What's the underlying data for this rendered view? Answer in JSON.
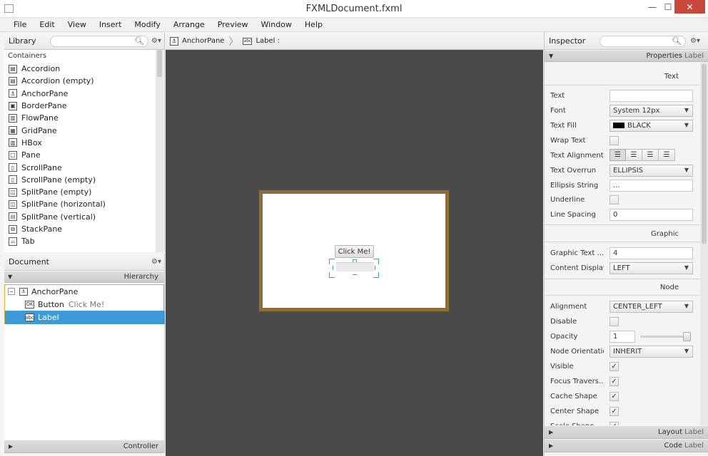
{
  "window": {
    "title": "FXMLDocument.fxml",
    "minimize_glyph": "—",
    "maximize_glyph": "☐",
    "close_glyph": "✕"
  },
  "menu": [
    "File",
    "Edit",
    "View",
    "Insert",
    "Modify",
    "Arrange",
    "Preview",
    "Window",
    "Help"
  ],
  "library": {
    "title": "Library",
    "section": "Containers",
    "items": [
      {
        "label": "Accordion",
        "icon": "▤"
      },
      {
        "label": "Accordion  (empty)",
        "icon": "▤"
      },
      {
        "label": "AnchorPane",
        "icon": "⚓"
      },
      {
        "label": "BorderPane",
        "icon": "▣"
      },
      {
        "label": "FlowPane",
        "icon": "▥"
      },
      {
        "label": "GridPane",
        "icon": "▦"
      },
      {
        "label": "HBox",
        "icon": "▥"
      },
      {
        "label": "Pane",
        "icon": "□"
      },
      {
        "label": "ScrollPane",
        "icon": "▯"
      },
      {
        "label": "ScrollPane  (empty)",
        "icon": "▯"
      },
      {
        "label": "SplitPane  (empty)",
        "icon": "◫"
      },
      {
        "label": "SplitPane  (horizontal)",
        "icon": "◫"
      },
      {
        "label": "SplitPane  (vertical)",
        "icon": "⊟"
      },
      {
        "label": "StackPane",
        "icon": "⧉"
      },
      {
        "label": "Tab",
        "icon": "⌓"
      }
    ]
  },
  "document": {
    "title": "Document",
    "hierarchy_label": "Hierarchy",
    "controller_label": "Controller",
    "tree": [
      {
        "label": "AnchorPane",
        "sub": "",
        "icon": "⚓",
        "toggle": "−"
      },
      {
        "label": "Button",
        "sub": "Click Me!",
        "icon": "OK",
        "toggle": ""
      },
      {
        "label": "Label",
        "sub": "",
        "icon": "abc",
        "toggle": ""
      }
    ]
  },
  "breadcrumb": {
    "items": [
      {
        "label": "AnchorPane",
        "icon": "⚓"
      },
      {
        "label": "Label :",
        "icon": "abc"
      }
    ]
  },
  "canvas": {
    "button_label": "Click Me!"
  },
  "inspector": {
    "title": "Inspector",
    "properties_label": "Properties",
    "properties_target": ": Label",
    "sections": {
      "text": "Text",
      "graphic": "Graphic",
      "node": "Node"
    },
    "rows": {
      "text": "Text",
      "font": "Font",
      "font_value": "System 12px",
      "text_fill": "Text Fill",
      "text_fill_value": "BLACK",
      "wrap_text": "Wrap Text",
      "text_alignment": "Text Alignment",
      "text_overrun": "Text Overrun",
      "text_overrun_value": "ELLIPSIS",
      "ellipsis_string": "Ellipsis String",
      "ellipsis_value": "...",
      "underline": "Underline",
      "line_spacing": "Line Spacing",
      "line_spacing_value": "0",
      "graphic_text_gap": "Graphic Text ...",
      "graphic_text_gap_value": "4",
      "content_display": "Content Display",
      "content_display_value": "LEFT",
      "alignment": "Alignment",
      "alignment_value": "CENTER_LEFT",
      "disable": "Disable",
      "opacity": "Opacity",
      "opacity_value": "1",
      "node_orientation": "Node Orientation",
      "node_orientation_value": "INHERIT",
      "visible": "Visible",
      "focus_traversable": "Focus Travers...",
      "cache_shape": "Cache Shape",
      "center_shape": "Center Shape",
      "scale_shape": "Scale Shape"
    },
    "layout_label": "Layout",
    "layout_target": ": Label",
    "code_label": "Code",
    "code_target": ": Label"
  },
  "colors": {
    "selection": "#3d9ad6",
    "canvas_bg": "#4a4a4a",
    "frame": "#8c6f36",
    "close_button": "#c9483c"
  }
}
